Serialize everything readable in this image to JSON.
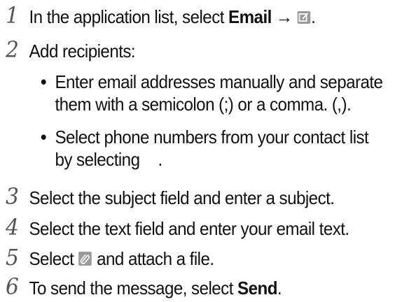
{
  "steps": [
    {
      "number": "1",
      "prefix": "In the application list, select ",
      "bold": "Email",
      "arrow": "→",
      "icon": "compose-icon",
      "suffix": "."
    },
    {
      "number": "2",
      "text": "Add recipients:",
      "bullets": [
        {
          "line1": "Enter email addresses manually and separate",
          "line2": "them with a semicolon (;) or a comma. (,)."
        },
        {
          "line1": "Select phone numbers from your contact list",
          "line2": "by selecting",
          "line2_end": "."
        }
      ]
    },
    {
      "number": "3",
      "text": "Select the subject field and enter a subject."
    },
    {
      "number": "4",
      "text": "Select the text field and enter your email text."
    },
    {
      "number": "5",
      "prefix": "Select ",
      "icon": "paperclip-icon",
      "suffix": " and attach a file."
    },
    {
      "number": "6",
      "prefix": "To send the message, select ",
      "bold": "Send",
      "suffix": "."
    }
  ],
  "colors": {
    "text": "#111111",
    "number": "#555555",
    "icon": "#8a8a8a"
  }
}
